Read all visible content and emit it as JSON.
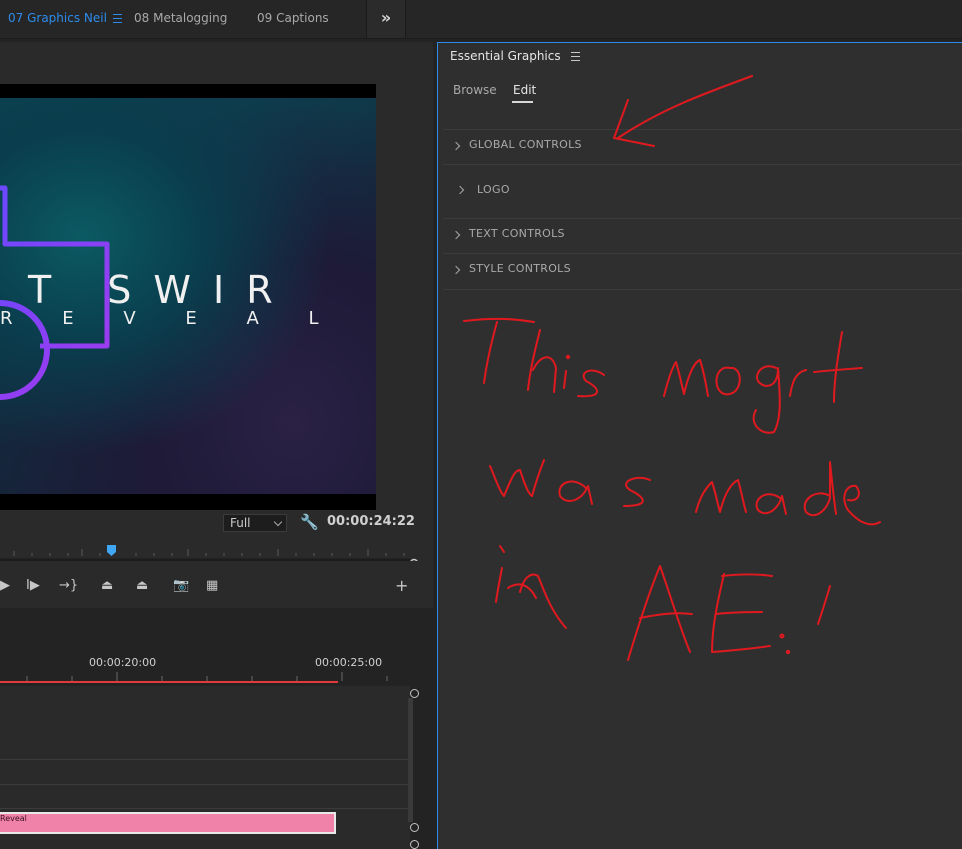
{
  "workspace_tabs": [
    {
      "label": "07 Graphics Neil",
      "active": true
    },
    {
      "label": "08 Metalogging",
      "active": false
    },
    {
      "label": "09 Captions",
      "active": false
    }
  ],
  "overflow_icon": "double-chevron-right-icon",
  "program_monitor": {
    "title_line1": "T SWIR",
    "title_line2": "R E V E A L",
    "zoom_value": "Full",
    "timecode": "00:00:24:22"
  },
  "timeline": {
    "ticks": [
      "00:00:20:00",
      "00:00:25:00"
    ],
    "clip_label": "Reveal"
  },
  "essential_graphics": {
    "title": "Essential Graphics",
    "tabs": [
      {
        "label": "Browse",
        "active": false
      },
      {
        "label": "Edit",
        "active": true
      }
    ],
    "sections": [
      "GLOBAL CONTROLS",
      "LOGO",
      "TEXT CONTROLS",
      "STYLE CONTROLS"
    ]
  },
  "annotation": {
    "text": "This mogrt was made in AE!",
    "color": "#e0191f"
  },
  "colors": {
    "accent": "#2d8ceb",
    "clip": "#f081a9",
    "playhead": "#3fa6f4",
    "in_out": "#e23a3a"
  }
}
